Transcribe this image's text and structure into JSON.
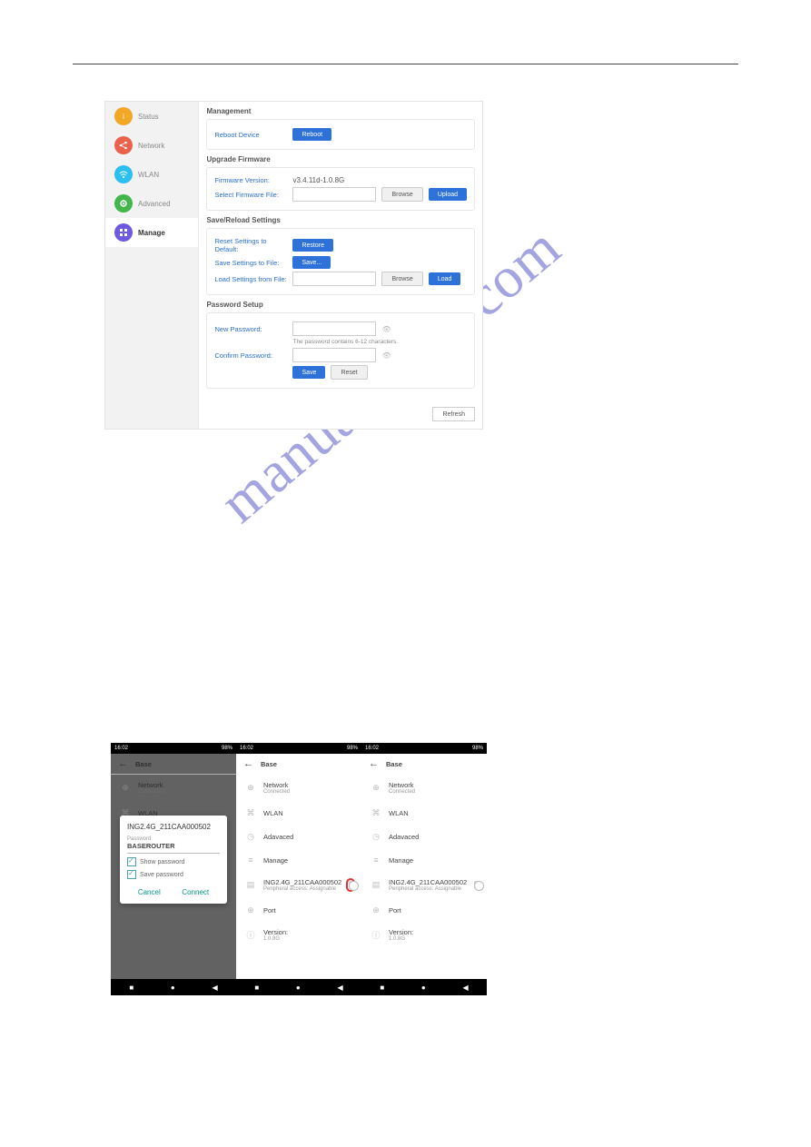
{
  "router": {
    "sidebar": {
      "items": [
        {
          "label": "Status",
          "color": "#f2a727"
        },
        {
          "label": "Network",
          "color": "#ea624b"
        },
        {
          "label": "WLAN",
          "color": "#2dbef0"
        },
        {
          "label": "Advanced",
          "color": "#42b54b"
        },
        {
          "label": "Manage",
          "color": "#6f59dd"
        }
      ],
      "active": 4
    },
    "management": {
      "title": "Management",
      "reboot_label": "Reboot Device",
      "reboot_button": "Reboot"
    },
    "upgrade": {
      "title": "Upgrade Firmware",
      "version_label": "Firmware Version:",
      "version_value": "v3.4.11d-1.0.8G",
      "select_label": "Select Firmware File:",
      "browse": "Browse",
      "upload": "Upload"
    },
    "save_reload": {
      "title": "Save/Reload Settings",
      "reset_label": "Reset Settings to Default:",
      "restore": "Restore",
      "save_label": "Save Settings to File:",
      "save": "Save...",
      "load_label": "Load Settings from File:",
      "browse": "Browse",
      "load": "Load"
    },
    "password": {
      "title": "Password Setup",
      "new_label": "New Password:",
      "hint": "The password contains 6-12 characters.",
      "confirm_label": "Confirm Password:",
      "save": "Save",
      "reset": "Reset"
    },
    "refresh": "Refresh"
  },
  "phones": {
    "statusbar": {
      "time": "16:02",
      "right": "98%"
    },
    "header": {
      "title": "Base"
    },
    "menu": {
      "network": {
        "title": "Network",
        "sub": "Connected"
      },
      "wlan": "WLAN",
      "advanced": "Adavaced",
      "manage": "Manage",
      "device": {
        "title": "ING2.4G_211CAA000502",
        "sub": "Peripheral access: Assignable"
      },
      "port": "Port",
      "version": {
        "title": "Version:",
        "sub": "1.0.8G"
      }
    },
    "dialog": {
      "ssid": "ING2.4G_211CAA000502",
      "pw_label": "Password",
      "pw_value": "BASEROUTER",
      "show_pw": "Show password",
      "save_pw": "Save password",
      "cancel": "Cancel",
      "connect": "Connect"
    }
  },
  "watermark": "manualshive.com"
}
